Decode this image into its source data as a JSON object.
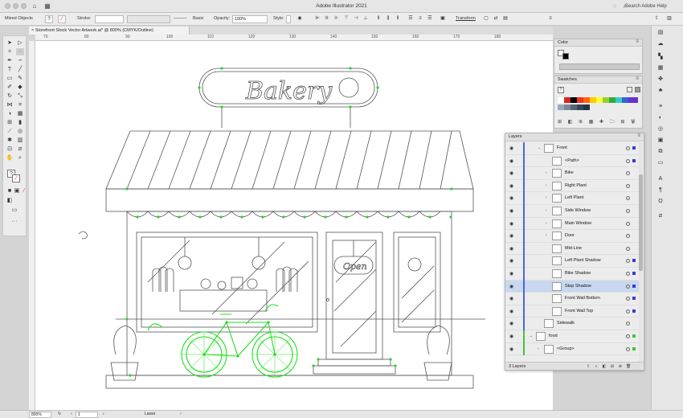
{
  "app": {
    "title": "Adobe Illustrator 2021",
    "search_placeholder": "Search Adobe Help"
  },
  "control_bar": {
    "selection_label": "Mixed Objects",
    "stroke_label": "Stroke:",
    "brush_label": "Basic",
    "opacity_label": "Opacity:",
    "opacity_value": "100%",
    "style_label": "Style:",
    "transform_label": "Transform"
  },
  "document": {
    "tab_label": "Storefront Stock Vector Artwork.ai* @ 800% (CMYK/Outline)",
    "close_glyph": "×",
    "ruler_marks": [
      "70",
      "80",
      "90",
      "100",
      "110",
      "120",
      "130",
      "140",
      "150",
      "160",
      "170",
      "180"
    ]
  },
  "artwork": {
    "sign_text": "Bakery",
    "open_sign_text": "Open"
  },
  "panels": {
    "color": {
      "title": "Color"
    },
    "swatches": {
      "title": "Swatches"
    },
    "layers": {
      "title": "Layers",
      "footer_count": "3 Layers",
      "rows": [
        {
          "name": "Front",
          "indent": 1,
          "arrow": "⌄",
          "bar": "#4a64e0",
          "sq": "#3b3bd8",
          "selected": false
        },
        {
          "name": "<Path>",
          "indent": 2,
          "arrow": "",
          "bar": "#4a64e0",
          "sq": "#3b3bd8",
          "selected": false
        },
        {
          "name": "Bike",
          "indent": 2,
          "arrow": "›",
          "bar": "#4a64e0",
          "sq": "",
          "selected": false
        },
        {
          "name": "Right Plant",
          "indent": 2,
          "arrow": "›",
          "bar": "#4a64e0",
          "sq": "",
          "selected": false
        },
        {
          "name": "Left Plant",
          "indent": 2,
          "arrow": "›",
          "bar": "#4a64e0",
          "sq": "",
          "selected": false
        },
        {
          "name": "Side Window",
          "indent": 2,
          "arrow": "›",
          "bar": "#4a64e0",
          "sq": "",
          "selected": false
        },
        {
          "name": "Main Window",
          "indent": 2,
          "arrow": "›",
          "bar": "#4a64e0",
          "sq": "",
          "selected": false
        },
        {
          "name": "Door",
          "indent": 2,
          "arrow": "›",
          "bar": "#4a64e0",
          "sq": "",
          "selected": false
        },
        {
          "name": "Mid-Line",
          "indent": 2,
          "arrow": "",
          "bar": "#4a64e0",
          "sq": "",
          "selected": false
        },
        {
          "name": "Left Plant Shadow",
          "indent": 2,
          "arrow": "",
          "bar": "#4a64e0",
          "sq": "#3b3bd8",
          "selected": false
        },
        {
          "name": "Bike Shadow",
          "indent": 2,
          "arrow": "",
          "bar": "#4a64e0",
          "sq": "#3b3bd8",
          "selected": false
        },
        {
          "name": "Step Shadow",
          "indent": 2,
          "arrow": "",
          "bar": "#4a64e0",
          "sq": "#3b3bd8",
          "selected": true
        },
        {
          "name": "Front Wall Bottom",
          "indent": 2,
          "arrow": "",
          "bar": "#4a64e0",
          "sq": "#3b3bd8",
          "selected": false
        },
        {
          "name": "Front Wall Top",
          "indent": 2,
          "arrow": "",
          "bar": "#4a64e0",
          "sq": "#3b3bd8",
          "selected": false
        },
        {
          "name": "Sidewalk",
          "indent": 1,
          "arrow": "",
          "bar": "#4a64e0",
          "sq": "",
          "selected": false
        },
        {
          "name": "food",
          "indent": 0,
          "arrow": "⌄",
          "bar": "#3ec43e",
          "sq": "#3ec43e",
          "selected": false
        },
        {
          "name": "<Group>",
          "indent": 1,
          "arrow": "›",
          "bar": "#3ec43e",
          "sq": "#3ec43e",
          "selected": false
        }
      ]
    }
  },
  "status_bar": {
    "zoom": "800%",
    "artboard": "1",
    "tool": "Lasso"
  },
  "colors": {
    "selection_blue": "#4a64e0",
    "selection_green": "#3ec43e",
    "row_selected": "#c7d8f0"
  }
}
